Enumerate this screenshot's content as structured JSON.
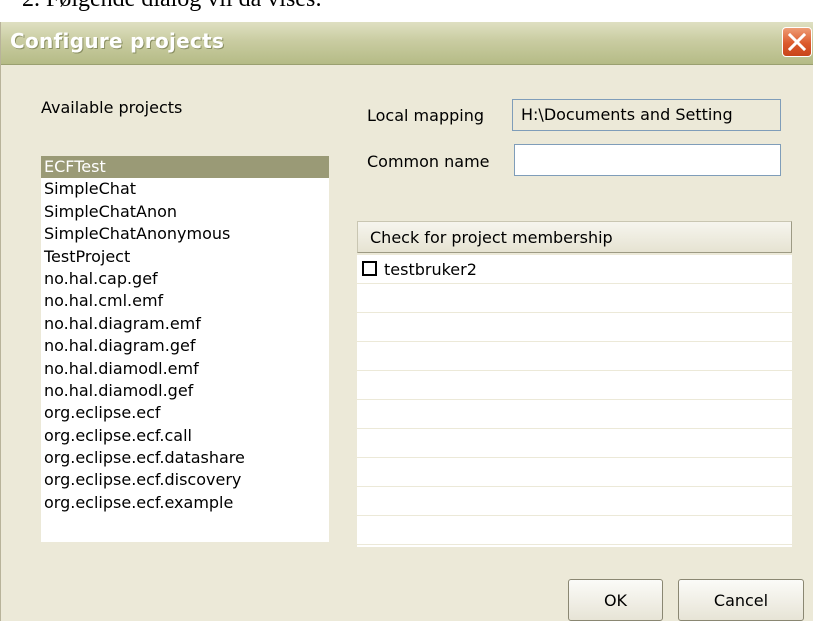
{
  "document": {
    "step_text": "2.   Følgende dialog vil da vises:"
  },
  "window": {
    "title": "Configure projects"
  },
  "projects": {
    "label": "Available projects",
    "items": [
      "ECFTest",
      "SimpleChat",
      "SimpleChatAnon",
      "SimpleChatAnonymous",
      "TestProject",
      "no.hal.cap.gef",
      "no.hal.cml.emf",
      "no.hal.diagram.emf",
      "no.hal.diagram.gef",
      "no.hal.diamodl.emf",
      "no.hal.diamodl.gef",
      "org.eclipse.ecf",
      "org.eclipse.ecf.call",
      "org.eclipse.ecf.datashare",
      "org.eclipse.ecf.discovery",
      "org.eclipse.ecf.example"
    ],
    "selected": "ECFTest"
  },
  "local_mapping": {
    "label": "Local mapping",
    "value": "H:\\Documents and Setting"
  },
  "common_name": {
    "label": "Common name",
    "value": ""
  },
  "membership": {
    "button_label": "Check for project membership",
    "rows": [
      {
        "label": "testbruker2",
        "checked": false
      }
    ]
  },
  "buttons": {
    "ok": "OK",
    "cancel": "Cancel"
  },
  "icons": {
    "close": "close-icon"
  },
  "colors": {
    "titlebar": "#c9cca1",
    "selection": "#9a9a76",
    "close_button": "#dc5a2c",
    "dialog_bg": "#ece9d8"
  }
}
